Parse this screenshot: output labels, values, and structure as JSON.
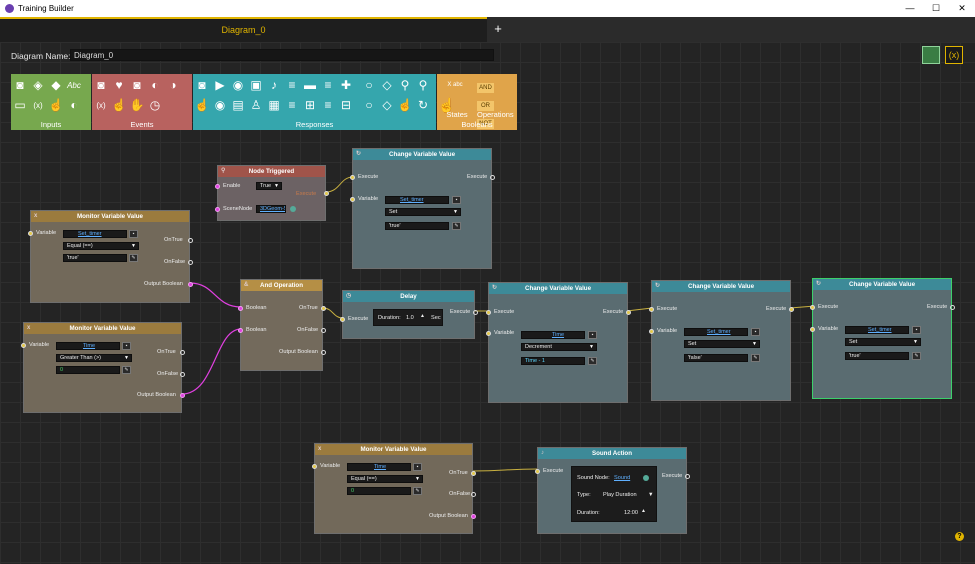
{
  "window": {
    "title": "Training Builder",
    "minimize": "—",
    "maximize": "☐",
    "close": "✕"
  },
  "tabs": {
    "active": "Diagram_0",
    "add": "+"
  },
  "diagram": {
    "name_label": "Diagram Name:",
    "name_value": "Diagram_0"
  },
  "toolbar": {
    "groups": [
      {
        "label": "Inputs",
        "color": "#77a84e",
        "icons": [
          "camera-icon",
          "node-icon",
          "cube-icon",
          "text-icon",
          "button-icon",
          "variable-icon",
          "hand-icon",
          "toggle-icon"
        ]
      },
      {
        "label": "Events",
        "color": "#b8625f",
        "icons": [
          "camera-icon",
          "heart-icon",
          "camera-icon",
          "toggle-icon",
          "toggle-icon",
          "variable-icon",
          "hand-icon",
          "hand-icon",
          "timer-icon"
        ]
      },
      {
        "label": "Responses",
        "color": "#35a6ad",
        "icons": [
          "camera-icon",
          "play-icon",
          "eye-icon",
          "tag-icon",
          "sound-icon",
          "list-icon",
          "car-icon",
          "list-icon",
          "move-icon",
          "hand-icon",
          "eye-icon",
          "chat-icon",
          "person-icon",
          "video-icon",
          "list-icon",
          "list-icon",
          "list-icon",
          "list-icon",
          "list-icon",
          "node-icon"
        ]
      },
      {
        "label": "",
        "color": "#35a6ad",
        "icons": [
          "circle-icon",
          "diamond-icon",
          "pin-icon",
          "pin-icon",
          "circle-icon",
          "diamond-icon",
          "hand-icon",
          "refresh-icon"
        ]
      },
      {
        "label": "States",
        "color": "#e0a44a",
        "icons": [
          "variable-icon",
          "hand-icon"
        ]
      },
      {
        "label": "Operations",
        "color": "#e0a44a",
        "icons": [
          "and-icon",
          "or-icon",
          "not-icon"
        ]
      },
      {
        "label": "Booleans",
        "color": "#e0a44a",
        "icons": []
      }
    ],
    "ops": {
      "and": "AND",
      "or": "OR",
      "not": "NOT",
      "x_abc": "X abc"
    }
  },
  "nodes": {
    "node_triggered": {
      "title": "Node Triggered",
      "enable_label": "Enable",
      "enable_value": "True",
      "scene_label": "SceneNode",
      "scene_value": "3DGeom-5",
      "execute_label": "Execute"
    },
    "cv1": {
      "title": "Change Variable Value",
      "execute_in": "Execute",
      "execute_out": "Execute",
      "variable_label": "Variable",
      "var_value": "Set_timer",
      "op_value": "Set",
      "val_value": "'true'"
    },
    "mon1": {
      "title": "Monitor Variable Value",
      "variable_label": "Variable",
      "var_value": "Set_timer",
      "op_value": "Equal (==)",
      "val_value": "'true'",
      "ontrue": "OnTrue",
      "onfalse": "OnFalse",
      "out_bool": "Output Boolean"
    },
    "mon2": {
      "title": "Monitor Variable Value",
      "variable_label": "Variable",
      "var_value": "Time",
      "op_value": "Greater Than (>)",
      "val_value": "0",
      "ontrue": "OnTrue",
      "onfalse": "OnFalse",
      "out_bool": "Output Boolean"
    },
    "and": {
      "title": "And Operation",
      "bool1": "Boolean",
      "bool2": "Boolean",
      "ontrue": "OnTrue",
      "onfalse": "OnFalse",
      "out_bool": "Output Boolean"
    },
    "delay": {
      "title": "Delay",
      "execute_in": "Execute",
      "execute_out": "Execute",
      "duration_label": "Duration:",
      "duration_value": "1.0",
      "unit": "Sec"
    },
    "cv2": {
      "title": "Change Variable Value",
      "execute_in": "Execute",
      "execute_out": "Execute",
      "variable_label": "Variable",
      "var_value": "Time",
      "op_value": "Decrement",
      "val_value": "Time - 1"
    },
    "cv3": {
      "title": "Change Variable Value",
      "execute_in": "Execute",
      "execute_out": "Execute",
      "variable_label": "Variable",
      "var_value": "Set_timer",
      "op_value": "Set",
      "val_value": "'false'"
    },
    "cv4": {
      "title": "Change Variable Value",
      "execute_in": "Execute",
      "execute_out": "Execute",
      "variable_label": "Variable",
      "var_value": "Set_timer",
      "op_value": "Set",
      "val_value": "'true'"
    },
    "mon3": {
      "title": "Monitor Variable Value",
      "variable_label": "Variable",
      "var_value": "Time",
      "op_value": "Equal (==)",
      "val_value": "0",
      "ontrue": "OnTrue",
      "onfalse": "OnFalse",
      "out_bool": "Output Boolean"
    },
    "sound": {
      "title": "Sound Action",
      "execute_in": "Execute",
      "execute_out": "Execute",
      "node_label": "Sound Node:",
      "node_value": "Sound",
      "type_label": "Type:",
      "type_value": "Play Duration",
      "duration_label": "Duration:",
      "duration_value": "12:00"
    }
  },
  "colors": {
    "accent": "#e0b400",
    "selected": "#3cd06b",
    "bool_wire": "#e040e0",
    "exec_wire": "#c8b040"
  }
}
